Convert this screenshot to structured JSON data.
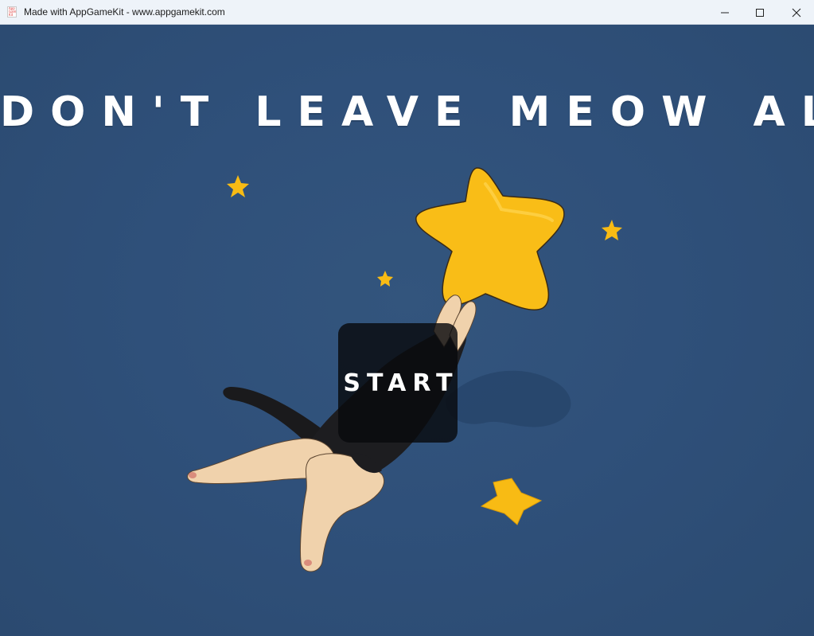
{
  "window": {
    "title": "Made with AppGameKit - www.appgamekit.com",
    "icon": "appgamekit-logo-icon",
    "icon_text": [
      "App",
      "Game",
      "Kit"
    ],
    "controls": [
      "minimize-icon",
      "maximize-icon",
      "close-icon"
    ]
  },
  "game": {
    "title": "DON'T LEAVE MEOW ALONE!",
    "start_label": "START",
    "colors": {
      "background": "#2e4e75",
      "star": "#f8bb14",
      "button": "#0a0c10",
      "text": "#ffffff"
    }
  }
}
